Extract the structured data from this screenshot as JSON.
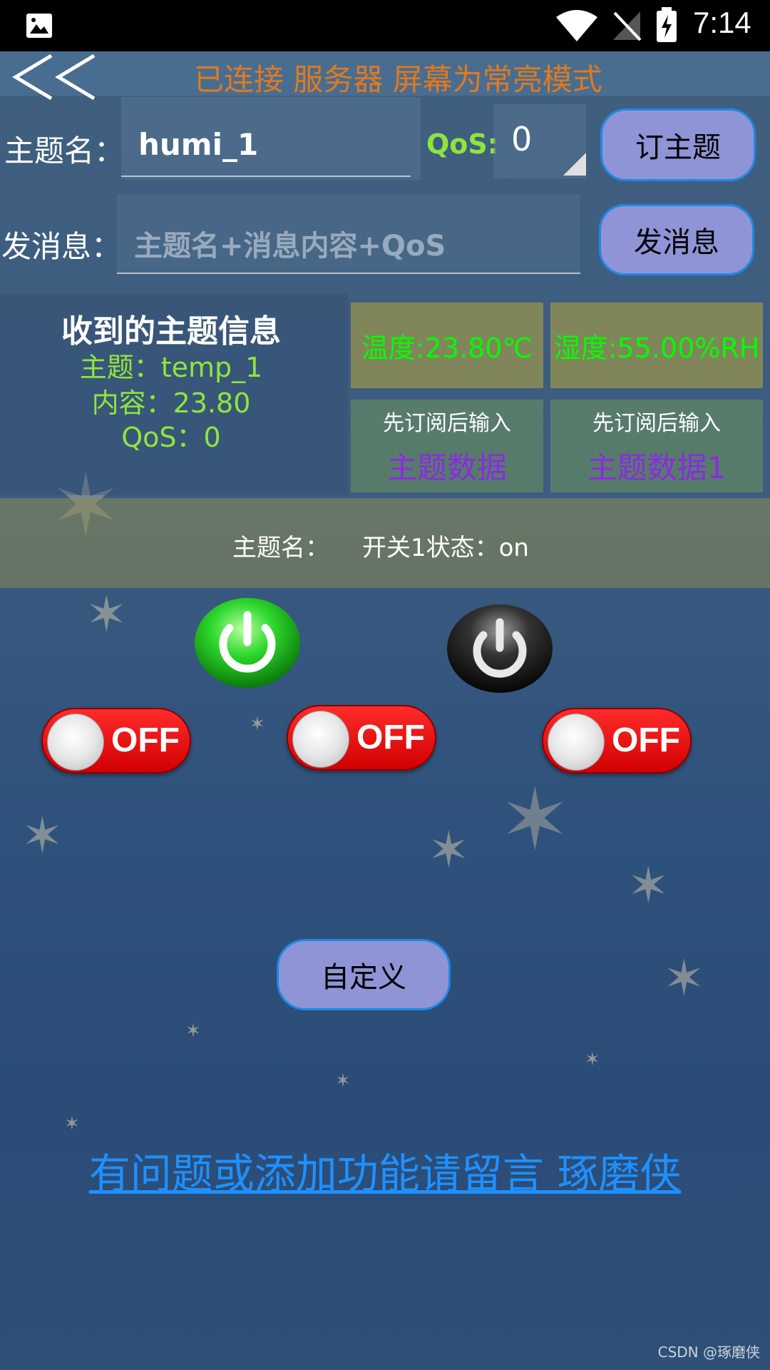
{
  "status_bar": {
    "time": "7:14"
  },
  "header": {
    "back_symbol": "<<",
    "connection_status": "已连接 服务器 屏幕为常亮模式"
  },
  "subscribe": {
    "topic_label": "主题名：",
    "topic_value": "humi_1",
    "qos_label": "QoS:",
    "qos_value": "0",
    "subscribe_button": "订主题"
  },
  "publish": {
    "label": "发消息：",
    "placeholder": "主题名+消息内容+QoS",
    "button": "发消息"
  },
  "received": {
    "title": "收到的主题信息",
    "topic_line": "主题：temp_1",
    "content_line": "内容：23.80",
    "qos_line": "QoS：0"
  },
  "readings": {
    "temperature": "温度:23.80℃",
    "humidity": "湿度:55.00%RH",
    "hint_1": "先订阅后输入",
    "hint_2": "先订阅后输入",
    "data_1": "主题数据",
    "data_2": "主题数据1"
  },
  "switch_status": {
    "topic_label": "主题名：",
    "state_text": "开关1状态：on"
  },
  "power_buttons": [
    {
      "icon": "power-on-icon",
      "color": "#1ed01e"
    },
    {
      "icon": "power-off-icon",
      "color": "#222222"
    }
  ],
  "toggles": [
    {
      "label": "OFF"
    },
    {
      "label": "OFF"
    },
    {
      "label": "OFF"
    }
  ],
  "custom_button": "自定义",
  "feedback_link": "有问题或添加功能请留言  琢磨侠",
  "watermark": "CSDN @琢磨侠",
  "colors": {
    "orange": "#e07a1f",
    "green": "#00ff00",
    "lime": "#8ee63c",
    "purple": "#8a2be2",
    "link": "#1e90ff",
    "button": "#8f94d6"
  }
}
